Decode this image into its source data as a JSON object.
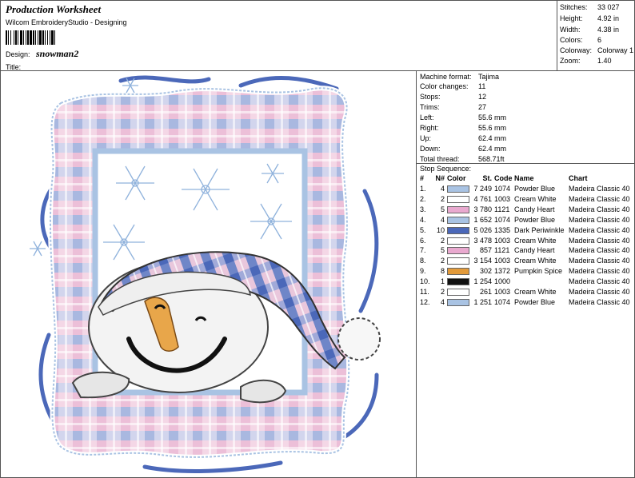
{
  "header": {
    "title": "Production Worksheet",
    "software": "Wilcom EmbroideryStudio - Designing",
    "design_label": "Design:",
    "design_name": "snowman2",
    "title_label": "Title:",
    "title_value": ""
  },
  "stats": [
    {
      "label": "Stitches:",
      "value": "33 027"
    },
    {
      "label": "Height:",
      "value": "4.92 in"
    },
    {
      "label": "Width:",
      "value": "4.38 in"
    },
    {
      "label": "Colors:",
      "value": "6"
    },
    {
      "label": "Colorway:",
      "value": "Colorway 1"
    },
    {
      "label": "Zoom:",
      "value": "1.40"
    }
  ],
  "machine": [
    {
      "label": "Machine format:",
      "value": "Tajima"
    },
    {
      "label": "Color changes:",
      "value": "11"
    },
    {
      "label": "Stops:",
      "value": "12"
    },
    {
      "label": "Trims:",
      "value": "27"
    },
    {
      "label": "Left:",
      "value": "55.6 mm"
    },
    {
      "label": "Right:",
      "value": "55.6 mm"
    },
    {
      "label": "Up:",
      "value": "62.4 mm"
    },
    {
      "label": "Down:",
      "value": "62.4 mm"
    },
    {
      "label": "Total thread:",
      "value": "568.71ft"
    }
  ],
  "stop_sequence": {
    "title": "Stop Sequence:",
    "headers": {
      "idx": "#",
      "n": "N#",
      "color": "Color",
      "st": "St.",
      "code": "Code",
      "name": "Name",
      "chart": "Chart"
    },
    "rows": [
      {
        "idx": "1.",
        "n": "4",
        "color": "#a9c3e3",
        "st": "7 249",
        "code": "1074",
        "name": "Powder Blue",
        "chart": "Madeira Classic 40"
      },
      {
        "idx": "2.",
        "n": "2",
        "color": "#ffffff",
        "st": "4 761",
        "code": "1003",
        "name": "Cream White",
        "chart": "Madeira Classic 40"
      },
      {
        "idx": "3.",
        "n": "5",
        "color": "#e9a9cf",
        "st": "3 780",
        "code": "1121",
        "name": "Candy Heart",
        "chart": "Madeira Classic 40"
      },
      {
        "idx": "4.",
        "n": "4",
        "color": "#a9c3e3",
        "st": "1 652",
        "code": "1074",
        "name": "Powder Blue",
        "chart": "Madeira Classic 40"
      },
      {
        "idx": "5.",
        "n": "10",
        "color": "#4b68b9",
        "st": "5 026",
        "code": "1335",
        "name": "Dark Periwinkle",
        "chart": "Madeira Classic 40"
      },
      {
        "idx": "6.",
        "n": "2",
        "color": "#ffffff",
        "st": "3 478",
        "code": "1003",
        "name": "Cream White",
        "chart": "Madeira Classic 40"
      },
      {
        "idx": "7.",
        "n": "5",
        "color": "#e9a9cf",
        "st": "857",
        "code": "1121",
        "name": "Candy Heart",
        "chart": "Madeira Classic 40"
      },
      {
        "idx": "8.",
        "n": "2",
        "color": "#ffffff",
        "st": "3 154",
        "code": "1003",
        "name": "Cream White",
        "chart": "Madeira Classic 40"
      },
      {
        "idx": "9.",
        "n": "8",
        "color": "#e29a3a",
        "st": "302",
        "code": "1372",
        "name": "Pumpkin Spice",
        "chart": "Madeira Classic 40"
      },
      {
        "idx": "10.",
        "n": "1",
        "color": "#111111",
        "st": "1 254",
        "code": "1000",
        "name": "",
        "chart": "Madeira Classic 40"
      },
      {
        "idx": "11.",
        "n": "2",
        "color": "#ffffff",
        "st": "261",
        "code": "1003",
        "name": "Cream White",
        "chart": "Madeira Classic 40"
      },
      {
        "idx": "12.",
        "n": "4",
        "color": "#a9c3e3",
        "st": "1 251",
        "code": "1074",
        "name": "Powder Blue",
        "chart": "Madeira Classic 40"
      }
    ]
  },
  "design_image": {
    "frame_pink": "#ecbdd6",
    "frame_blue": "#a9c3e3",
    "periwinkle": "#4b68b9",
    "snowflake": "#8fb2dc",
    "nose": "#e8a64a"
  }
}
